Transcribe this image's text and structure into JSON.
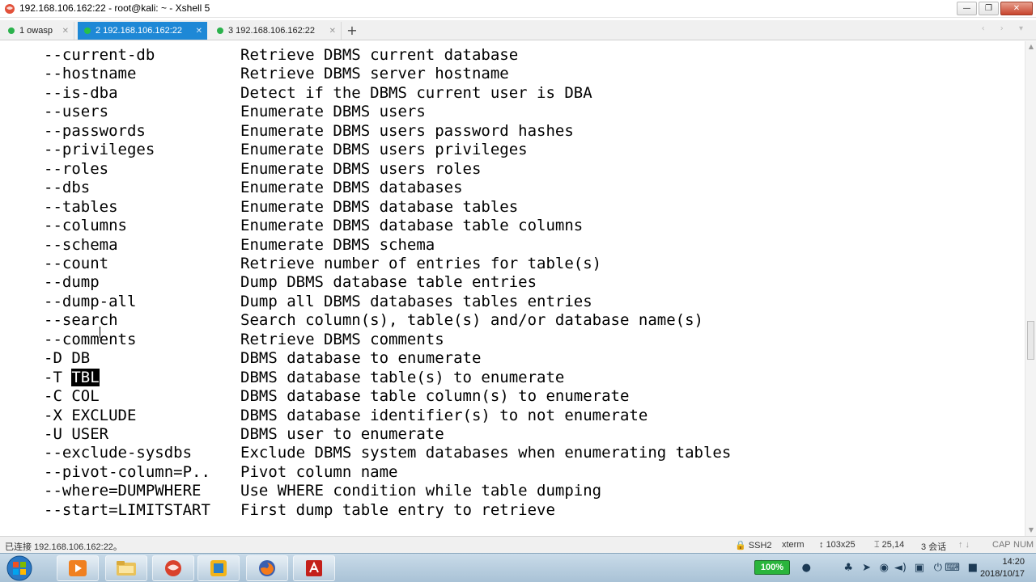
{
  "window": {
    "title": "192.168.106.162:22 - root@kali: ~ - Xshell 5",
    "buttons": {
      "minimize": "—",
      "restore": "❐",
      "close": "✕"
    }
  },
  "tabs": [
    {
      "label": "1 owasp",
      "active": false
    },
    {
      "label": "2 192.168.106.162:22",
      "active": true
    },
    {
      "label": "3 192.168.106.162:22",
      "active": false
    }
  ],
  "tabbar": {
    "add": "+",
    "nav": "‹ › ▾"
  },
  "terminal": {
    "lines": [
      {
        "opt": "--current-db",
        "desc": "Retrieve DBMS current database"
      },
      {
        "opt": "--hostname",
        "desc": "Retrieve DBMS server hostname"
      },
      {
        "opt": "--is-dba",
        "desc": "Detect if the DBMS current user is DBA"
      },
      {
        "opt": "--users",
        "desc": "Enumerate DBMS users"
      },
      {
        "opt": "--passwords",
        "desc": "Enumerate DBMS users password hashes"
      },
      {
        "opt": "--privileges",
        "desc": "Enumerate DBMS users privileges"
      },
      {
        "opt": "--roles",
        "desc": "Enumerate DBMS users roles"
      },
      {
        "opt": "--dbs",
        "desc": "Enumerate DBMS databases"
      },
      {
        "opt": "--tables",
        "desc": "Enumerate DBMS database tables"
      },
      {
        "opt": "--columns",
        "desc": "Enumerate DBMS database table columns"
      },
      {
        "opt": "--schema",
        "desc": "Enumerate DBMS schema"
      },
      {
        "opt": "--count",
        "desc": "Retrieve number of entries for table(s)"
      },
      {
        "opt": "--dump",
        "desc": "Dump DBMS database table entries"
      },
      {
        "opt": "--dump-all",
        "desc": "Dump all DBMS databases tables entries"
      },
      {
        "opt": "--search",
        "desc": "Search column(s), table(s) and/or database name(s)"
      },
      {
        "opt": "--comments",
        "desc": "Retrieve DBMS comments"
      },
      {
        "opt": "-D DB",
        "desc": "DBMS database to enumerate"
      },
      {
        "opt_prefix": "-T ",
        "opt_sel": "TBL",
        "desc": "DBMS database table(s) to enumerate"
      },
      {
        "opt": "-C COL",
        "desc": "DBMS database table column(s) to enumerate"
      },
      {
        "opt": "-X EXCLUDE",
        "desc": "DBMS database identifier(s) to not enumerate"
      },
      {
        "opt": "-U USER",
        "desc": "DBMS user to enumerate"
      },
      {
        "opt": "--exclude-sysdbs",
        "desc": "Exclude DBMS system databases when enumerating tables"
      },
      {
        "opt": "--pivot-column=P..",
        "desc": "Pivot column name"
      },
      {
        "opt": "--where=DUMPWHERE",
        "desc": "Use WHERE condition while table dumping"
      },
      {
        "opt": "--start=LIMITSTART",
        "desc": "First dump table entry to retrieve"
      }
    ]
  },
  "statusbar": {
    "connection": "已连接 192.168.106.162:22。",
    "protocol": "SSH2",
    "terminal_type": "xterm",
    "size": "103x25",
    "cursor_pos": "25,14",
    "sessions": "3 会话",
    "caps": "CAP",
    "num": "NUM"
  },
  "taskbar": {
    "battery": "100%",
    "time": "14:20",
    "date": "2018/10/17"
  },
  "colors": {
    "tab_active": "#1e88d6",
    "session_dot": "#2bb24c",
    "battery": "#2ab53c"
  }
}
